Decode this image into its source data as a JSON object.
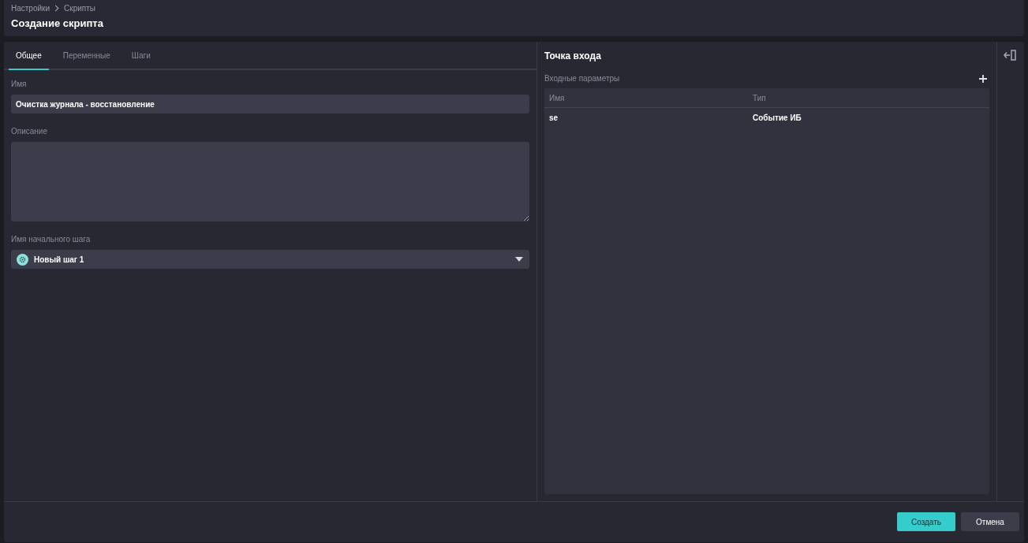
{
  "breadcrumb": [
    "Настройки",
    "Скрипты"
  ],
  "title": "Создание скрипта",
  "tabs": [
    {
      "label": "Общее",
      "selected": true
    },
    {
      "label": "Переменные",
      "selected": false
    },
    {
      "label": "Шаги",
      "selected": false
    }
  ],
  "form": {
    "name": {
      "label": "Имя",
      "value": "Очистка журнала - восстановление"
    },
    "description": {
      "label": "Описание"
    },
    "start_step": {
      "label": "Имя начального шага",
      "value": "Новый шаг 1"
    }
  },
  "entry_point": {
    "title": "Точка входа",
    "params_label": "Входные параметры",
    "table": {
      "columns": [
        "Имя",
        "Тип"
      ],
      "rows": [
        [
          "se",
          "Событие ИБ"
        ]
      ]
    }
  },
  "buttons": [
    {
      "label": "Создать",
      "kind": "primary"
    },
    {
      "label": "Отмена",
      "kind": "secondary"
    }
  ]
}
